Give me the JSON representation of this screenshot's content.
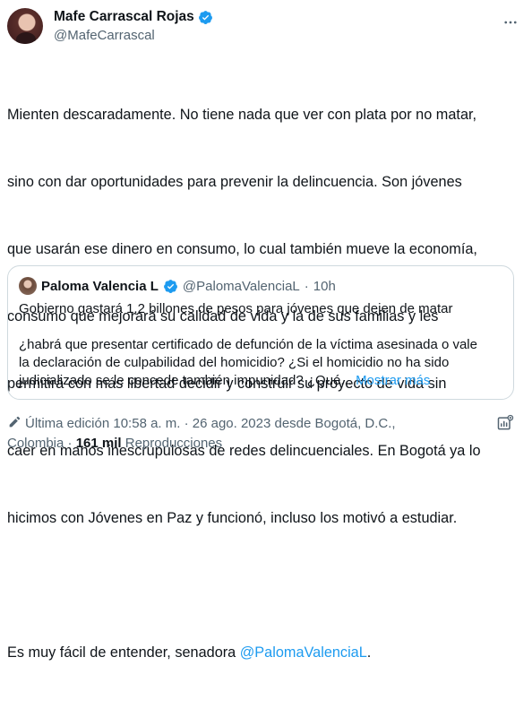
{
  "author": {
    "display_name": "Mafe Carrascal Rojas",
    "handle": "@MafeCarrascal",
    "verified": true
  },
  "tweet": {
    "lines": [
      "Mienten descaradamente. No tiene nada que ver con plata por no matar,",
      "sino con dar oportunidades para prevenir la delincuencia. Son jóvenes",
      "que usarán ese dinero en consumo, lo cual también mueve la economía,",
      "consumo que mejorará su calidad de vida y la de sus familias y les",
      "permitirá con más libertad decidir y construir su proyecto de vida sin",
      "caer en manos inescrupulosas de redes delincuenciales. En Bogotá ya lo",
      "hicimos con Jóvenes en Paz y funcionó, incluso los motivó a estudiar."
    ],
    "closing_prefix": "Es muy fácil de entender, senadora ",
    "closing_mention": "@PalomaValenciaL",
    "closing_suffix": "."
  },
  "quote": {
    "display_name": "Paloma Valencia L",
    "handle": "@PalomaValenciaL",
    "separator": "·",
    "time": "10h",
    "line1": "Gobierno gastará  1,2 billones de pesos para jóvenes que dejen de matar",
    "line2": "¿habrá que presentar certificado de defunción de la víctima asesinada o vale",
    "line3": "la declaración de culpabilidad del homicidio? ¿Si el homicidio no ha sido",
    "line4": "judicializado se le concede también impunidad? ¿Qué...",
    "show_more": "Mostrar más"
  },
  "meta": {
    "edited_text": "Última edición 10:58 a. m. · 26 ago. 2023 desde Bogotá, D.C.,",
    "location_tail": "Colombia · ",
    "views_count": "161 mil",
    "views_label": " Reproducciones"
  },
  "colors": {
    "accent": "#1d9bf0",
    "text": "#0f1419",
    "secondary": "#536471",
    "border": "#cfd9de"
  },
  "icons": [
    "verified-badge-icon",
    "more-options-icon",
    "edit-pencil-icon",
    "analytics-icon"
  ]
}
